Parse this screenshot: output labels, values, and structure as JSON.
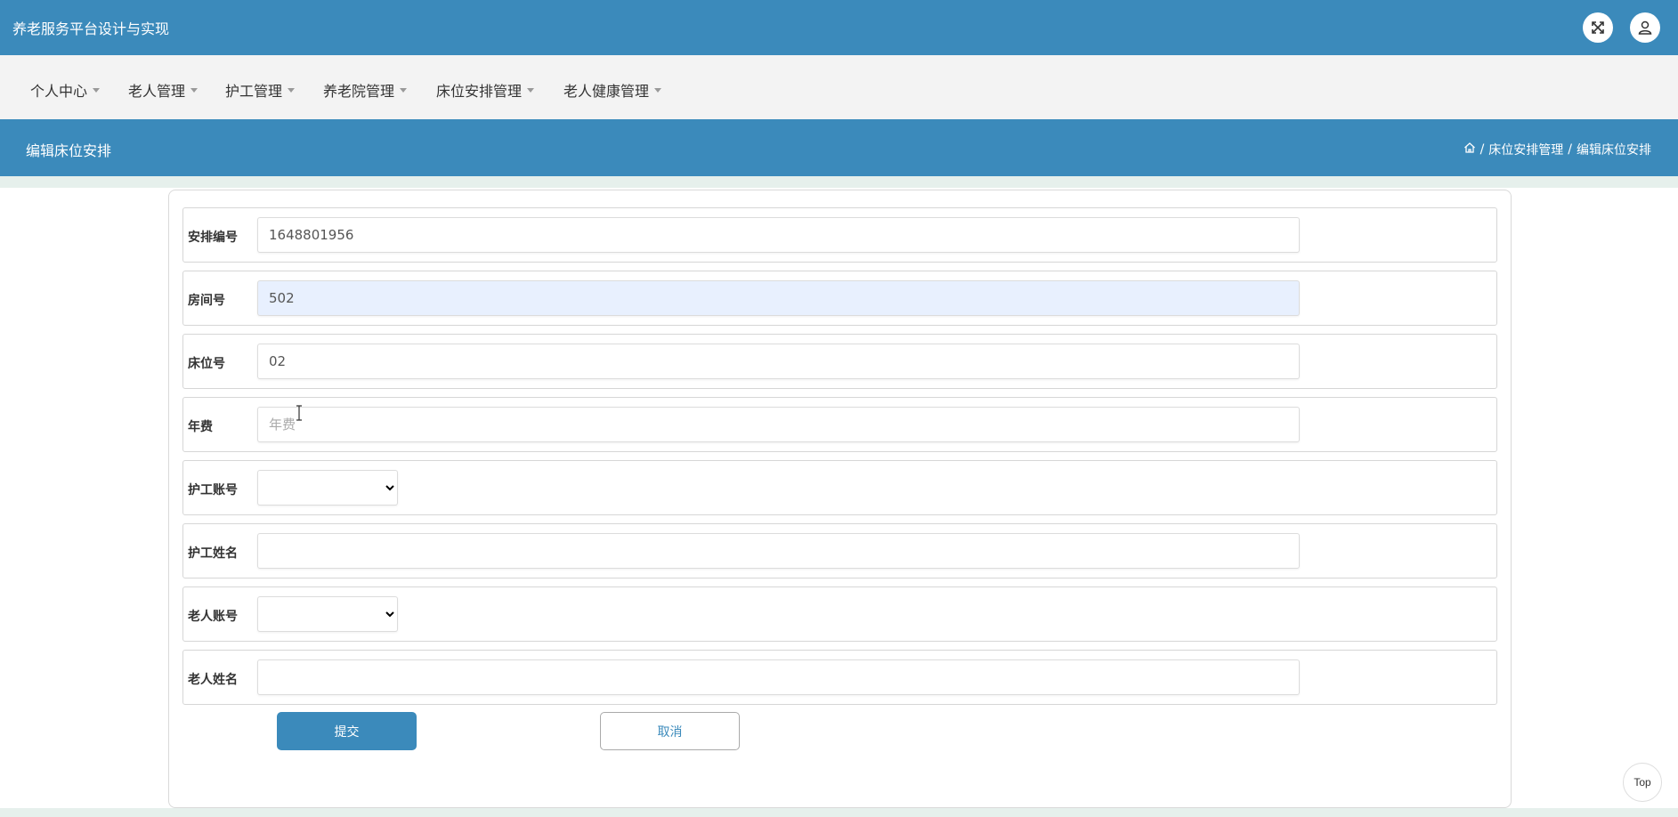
{
  "header": {
    "app_title": "养老服务平台设计与实现",
    "fullscreen_icon": "fullscreen-icon",
    "user_icon": "user-icon"
  },
  "nav": {
    "items": [
      {
        "label": "个人中心"
      },
      {
        "label": "老人管理"
      },
      {
        "label": "护工管理"
      },
      {
        "label": "养老院管理"
      },
      {
        "label": "床位安排管理"
      },
      {
        "label": "老人健康管理"
      }
    ]
  },
  "page": {
    "title": "编辑床位安排",
    "breadcrumb": {
      "home_icon": "home-icon",
      "sep": "/",
      "level1": "床位安排管理",
      "level2": "编辑床位安排"
    }
  },
  "form": {
    "arrangement_no": {
      "label": "安排编号",
      "value": "1648801956"
    },
    "room_no": {
      "label": "房间号",
      "value": "502"
    },
    "bed_no": {
      "label": "床位号",
      "value": "02"
    },
    "annual_fee": {
      "label": "年费",
      "value": "",
      "placeholder": "年费"
    },
    "caregiver_account": {
      "label": "护工账号",
      "selected": ""
    },
    "caregiver_name": {
      "label": "护工姓名",
      "value": ""
    },
    "elder_account": {
      "label": "老人账号",
      "selected": ""
    },
    "elder_name": {
      "label": "老人姓名",
      "value": ""
    },
    "submit_label": "提交",
    "cancel_label": "取消"
  },
  "back_to_top": "Top",
  "colors": {
    "primary": "#3b8abb",
    "nav_bg": "#f3f3f3",
    "page_bg": "#e6f0ec",
    "highlight_input": "#e8f0fe"
  }
}
